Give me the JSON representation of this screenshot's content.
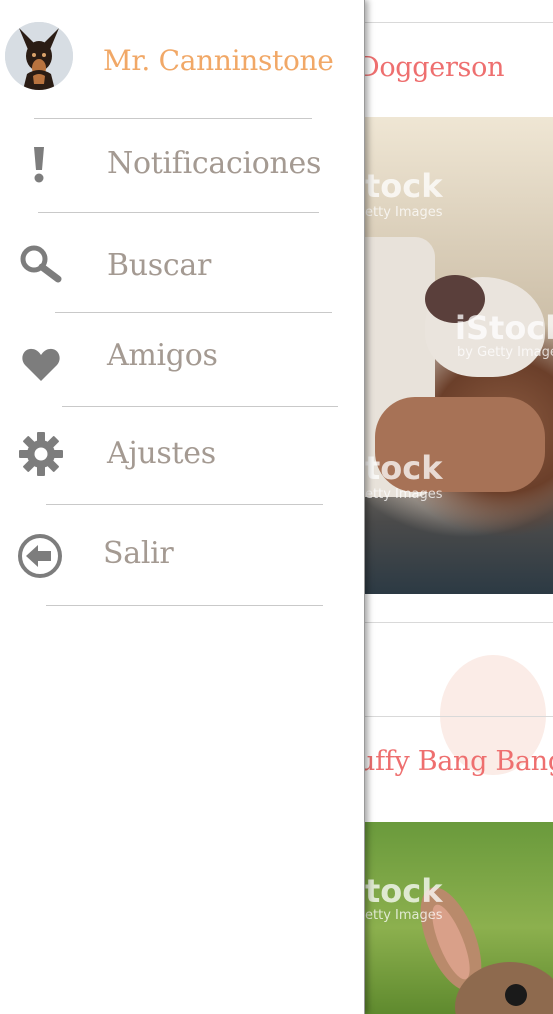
{
  "feed": {
    "posts": [
      {
        "name": "Doggerson",
        "image_watermarks": [
          "tock",
          "etty Images",
          "iStock",
          "by Getty Images",
          "tock",
          "etty Images"
        ]
      },
      {
        "name": "uffy Bang Bang",
        "image_watermarks": [
          "tock",
          "etty Images"
        ]
      }
    ]
  },
  "drawer": {
    "user": {
      "name": "Mr. Canninstone",
      "avatar_icon": "doberman-avatar"
    },
    "menu": [
      {
        "label": "Notificaciones",
        "icon": "exclamation-icon"
      },
      {
        "label": "Buscar",
        "icon": "search-icon"
      },
      {
        "label": "Amigos",
        "icon": "heart-icon"
      },
      {
        "label": "Ajustes",
        "icon": "gear-icon"
      },
      {
        "label": "Salir",
        "icon": "logout-arrow-icon"
      }
    ]
  },
  "colors": {
    "username": "#f1a867",
    "menu_text": "#a49a92",
    "menu_icon": "#7d7d7d",
    "feed_name": "#ee6f6f"
  }
}
